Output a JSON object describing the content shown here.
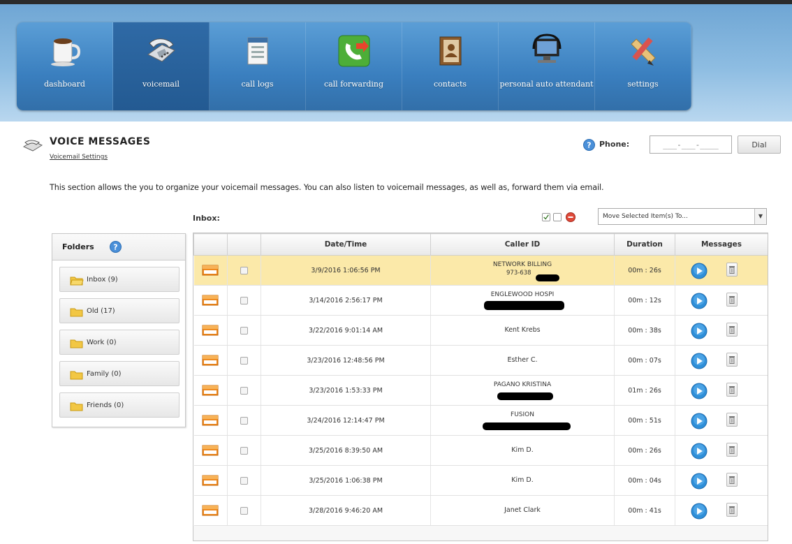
{
  "nav": {
    "items": [
      {
        "label": "dashboard",
        "icon": "coffee-mug-icon"
      },
      {
        "label": "voicemail",
        "icon": "telephone-icon",
        "active": true
      },
      {
        "label": "call logs",
        "icon": "call-log-document-icon"
      },
      {
        "label": "call forwarding",
        "icon": "call-forward-phone-icon"
      },
      {
        "label": "contacts",
        "icon": "address-book-icon"
      },
      {
        "label": "personal auto attendant",
        "icon": "computer-headset-icon"
      },
      {
        "label": "settings",
        "icon": "ruler-pencil-icon"
      }
    ]
  },
  "header": {
    "title": "VOICE MESSAGES",
    "settings_link": "Voicemail Settings",
    "phone_label": "Phone:",
    "phone_placeholder": "___-___-____",
    "dial_label": "Dial"
  },
  "description": "This section allows the you to organize your voicemail messages. You can also listen to voicemail messages, as well as, forward them via email.",
  "folders": {
    "title": "Folders",
    "items": [
      "Inbox (9)",
      "Old (17)",
      "Work (0)",
      "Family (0)",
      "Friends (0)"
    ]
  },
  "inbox": {
    "label": "Inbox:",
    "move_placeholder": "Move Selected Item(s) To..."
  },
  "table": {
    "columns": [
      "",
      "",
      "Date/Time",
      "Caller ID",
      "Duration",
      "Messages"
    ],
    "rows": [
      {
        "datetime": "3/9/2016 1:06:56 PM",
        "caller": "NETWORK BILLING",
        "caller_number": "973-638",
        "duration": "00m : 26s",
        "highlight": true
      },
      {
        "datetime": "3/14/2016 2:56:17 PM",
        "caller": "ENGLEWOOD HOSPI",
        "caller_number": "",
        "duration": "00m : 12s"
      },
      {
        "datetime": "3/22/2016 9:01:14 AM",
        "caller": "Kent Krebs",
        "caller_number": "",
        "duration": "00m : 38s"
      },
      {
        "datetime": "3/23/2016 12:48:56 PM",
        "caller": "Esther C.",
        "caller_number": "",
        "duration": "00m : 07s"
      },
      {
        "datetime": "3/23/2016 1:53:33 PM",
        "caller": "PAGANO KRISTINA",
        "caller_number": "",
        "duration": "01m : 26s"
      },
      {
        "datetime": "3/24/2016 12:14:47 PM",
        "caller": "FUSION",
        "caller_number": "",
        "duration": "00m : 51s"
      },
      {
        "datetime": "3/25/2016 8:39:50 AM",
        "caller": "Kim D.",
        "caller_number": "",
        "duration": "00m : 26s"
      },
      {
        "datetime": "3/25/2016 1:06:38 PM",
        "caller": "Kim D.",
        "caller_number": "",
        "duration": "00m : 04s"
      },
      {
        "datetime": "3/28/2016 9:46:20 AM",
        "caller": "Janet Clark",
        "caller_number": "",
        "duration": "00m : 41s"
      }
    ]
  },
  "colors": {
    "nav_bg": "#3a7fbf",
    "nav_active": "#235a92",
    "highlight_row": "#fbe9a9",
    "envelope": "#f08a1e",
    "play_button": "#2f8fd8"
  }
}
